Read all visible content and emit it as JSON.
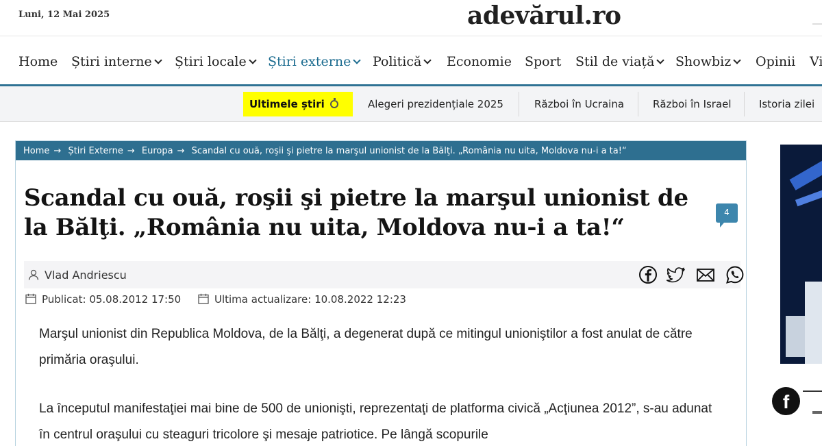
{
  "header": {
    "date": "Luni, 12 Mai 2025",
    "logo": "adevarul.ro",
    "logo_display": "adevărul.ro"
  },
  "nav": {
    "items": [
      {
        "label": "Home",
        "dropdown": false
      },
      {
        "label": "Știri interne",
        "dropdown": true
      },
      {
        "label": "Știri locale",
        "dropdown": true
      },
      {
        "label": "Știri externe",
        "dropdown": true,
        "active": true
      },
      {
        "label": "Politică",
        "dropdown": true
      },
      {
        "label": "Economie",
        "dropdown": false
      },
      {
        "label": "Sport",
        "dropdown": false
      },
      {
        "label": "Stil de viață",
        "dropdown": true
      },
      {
        "label": "Showbiz",
        "dropdown": true
      },
      {
        "label": "Opinii",
        "dropdown": false
      },
      {
        "label": "Vi",
        "dropdown": false
      }
    ]
  },
  "subnav": {
    "ultime": "Ultimele știri",
    "items": [
      "Alegeri prezidențiale 2025",
      "Război în Ucraina",
      "Război în Israel",
      "Istoria zilei"
    ]
  },
  "breadcrumb": {
    "items": [
      "Home",
      "Știri Externe",
      "Europa"
    ],
    "current": "Scandal cu ouă, roşii şi pietre la marşul unionist de la Bălţi. „România nu uita, Moldova nu-i a ta!“"
  },
  "article": {
    "title": "Scandal cu ouă, roşii şi pietre la marşul unionist de la Bălţi. „România nu uita, Moldova nu-i a ta!“",
    "comments_count": "4",
    "author": "Vlad Andriescu",
    "published_label": "Publicat:",
    "published": "05.08.2012 17:50",
    "updated_label": "Ultima actualizare:",
    "updated": "10.08.2022 12:23",
    "paragraphs": [
      "Marşul unionist din Republica Moldova, de la Bălţi, a degenerat după ce mitingul unioniştilor a fost anulat de către primăria oraşului.",
      "La începutul manifestaţiei mai bine de 500 de unionişti, reprezentaţi de platforma civică „Acţiunea 2012”, s-au adunat în centrul oraşului cu steaguri tricolore şi mesaje patriotice. Pe lângă scopurile"
    ]
  },
  "share": {
    "icons": [
      "facebook-icon",
      "twitter-icon",
      "email-icon",
      "whatsapp-icon"
    ]
  },
  "sidebar": {
    "social": "f"
  },
  "colors": {
    "accent": "#2e6f90",
    "active_nav": "#1b6b8f",
    "highlight": "#ffff00",
    "comment_badge": "#3d86ad"
  }
}
